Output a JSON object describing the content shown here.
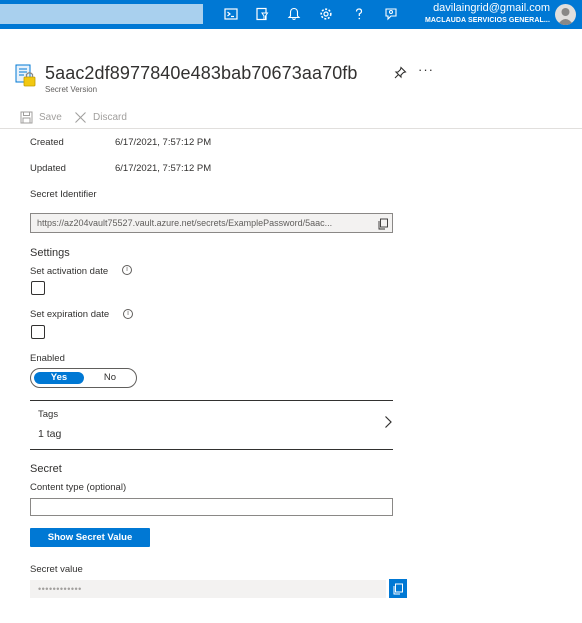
{
  "topbar": {
    "account_email": "davilaingrid@gmail.com",
    "account_org": "MACLAUDA SERVICIOS GENERAL...",
    "icons": [
      "cloud-shell-icon",
      "directory-filter-icon",
      "notifications-icon",
      "settings-icon",
      "help-icon",
      "feedback-icon"
    ]
  },
  "header": {
    "title": "5aac2df8977840e483bab70673aa70fb",
    "subtitle": "Secret Version",
    "more": "···"
  },
  "toolbar": {
    "save_label": "Save",
    "discard_label": "Discard"
  },
  "properties": {
    "created_label": "Created",
    "created_value": "6/17/2021, 7:57:12 PM",
    "updated_label": "Updated",
    "updated_value": "6/17/2021, 7:57:12 PM",
    "identifier_label": "Secret Identifier",
    "identifier_value": "https://az204vault75527.vault.azure.net/secrets/ExamplePassword/5aac..."
  },
  "settings": {
    "heading": "Settings",
    "activation_label": "Set activation date",
    "activation_checked": false,
    "expiration_label": "Set expiration date",
    "expiration_checked": false,
    "enabled_label": "Enabled",
    "enabled_yes": "Yes",
    "enabled_no": "No",
    "enabled_value": "Yes"
  },
  "tags": {
    "label": "Tags",
    "value": "1 tag"
  },
  "secret": {
    "heading": "Secret",
    "content_type_label": "Content type (optional)",
    "content_type_value": "",
    "show_button": "Show Secret Value",
    "secret_value_label": "Secret value",
    "secret_value_masked": "••••••••••••"
  },
  "colors": {
    "accent": "#0078d4",
    "text": "#323130",
    "muted": "#605e5c"
  }
}
